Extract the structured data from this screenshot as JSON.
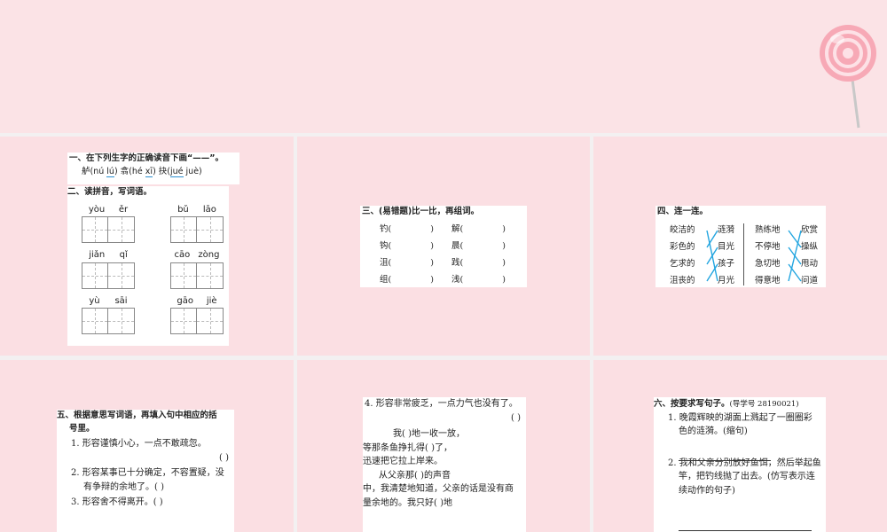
{
  "colors": {
    "background": "#fbe3e6",
    "accent_line": "#22a5e0",
    "pin": "#ea7b8e"
  },
  "icons": {
    "lollipop": "lollipop-icon",
    "pin": "pushpin-icon"
  },
  "slide1": {
    "q1_title": "一、在下列生字的正确读音下画“——”。",
    "q1_line": [
      "舻(nú",
      "lú",
      ") 翕(hé",
      "xī",
      ") 抉(",
      "jué",
      " juè)"
    ],
    "q2_title": "二、读拼音，写词语。",
    "pinyin": [
      [
        "yòu",
        "ěr"
      ],
      [
        "bǔ",
        "lāo"
      ],
      [
        "jiǎn",
        "qǐ"
      ],
      [
        "cāo",
        "zòng"
      ],
      [
        "yù",
        "sāi"
      ],
      [
        "gāo",
        "jiè"
      ]
    ]
  },
  "slide2": {
    "q3_title": "三、(易错题)比一比，再组词。",
    "pairs": [
      [
        "钓(",
        ")",
        "解(",
        ")"
      ],
      [
        "钩(",
        ")",
        "晨(",
        ")"
      ],
      [
        "沮(",
        ")",
        "践(",
        ")"
      ],
      [
        "组(",
        ")",
        "浅(",
        ")"
      ]
    ]
  },
  "slide3": {
    "q4_title": "四、连一连。",
    "left_a": [
      "皎洁的",
      "彩色的",
      "乞求的",
      "沮丧的"
    ],
    "right_a": [
      "涟漪",
      "目光",
      "孩子",
      "月光"
    ],
    "left_b": [
      "熟练地",
      "不停地",
      "急切地",
      "得意地"
    ],
    "right_b": [
      "欣赏",
      "操纵",
      "甩动",
      "问道"
    ]
  },
  "slide4": {
    "q5_title": "五、根据意思写词语，再填入句中相应的括",
    "q5_title2": "号里。",
    "item1": "1. 形容谨慎小心，一点不敢疏忽。",
    "item1_paren": "(             )",
    "item2a": "2. 形容某事已十分确定，不容置疑，没",
    "item2b": "有争辩的余地了。(             )",
    "item3": "3. 形容舍不得离开。(             )"
  },
  "slide5": {
    "item4": "4. 形容非常疲乏，一点力气也没有了。",
    "item4_paren": "(             )",
    "p1": "我(          )地一收一放，",
    "p2": "等那条鱼挣扎得(          )了，",
    "p3": "迅速把它拉上岸来。",
    "p4": "从父亲那(          )的声音",
    "p5": "中，我清楚地知道，父亲的话是没有商",
    "p6": "量余地的。我只好(          )地"
  },
  "slide6": {
    "q6_title": "六、按要求写句子。",
    "q6_note": "(导学号 28190021)",
    "s1a": "1. 晚霞辉映的湖面上溅起了一圈圈彩",
    "s1b": "色的涟漪。(缩句)",
    "s2a": "2. 我和父亲分别放好鱼饵，然后举起鱼",
    "s2b": "竿，把钓线抛了出去。(仿写表示连",
    "s2c": "续动作的句子)"
  }
}
